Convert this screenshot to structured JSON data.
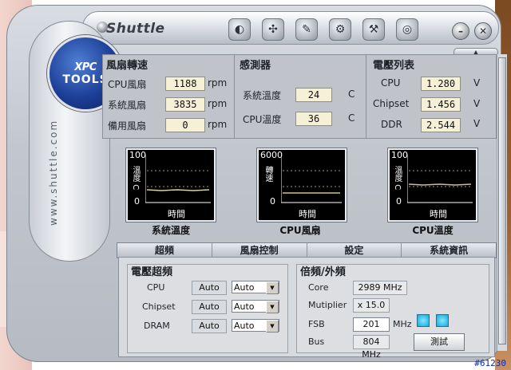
{
  "brand": "Shuttle",
  "logo": {
    "line1": "XPC",
    "line2": "TOOLS"
  },
  "side_url": "www.shuttle.com",
  "toolbar_icons": [
    "monitor-icon",
    "fan-icon",
    "wrench-icon",
    "gear-icon",
    "tools-icon",
    "lifebuoy-icon"
  ],
  "window_buttons": {
    "minimize": "–",
    "close": "✕"
  },
  "eject_label": "▲",
  "fans": {
    "title": "風扇轉速",
    "rows": [
      {
        "label": "CPU風扇",
        "value": "1188",
        "unit": "rpm"
      },
      {
        "label": "系統風扇",
        "value": "3835",
        "unit": "rpm"
      },
      {
        "label": "備用風扇",
        "value": "0",
        "unit": "rpm"
      }
    ]
  },
  "sensors": {
    "title": "感測器",
    "rows": [
      {
        "label": "系統溫度",
        "value": "24",
        "unit": "C"
      },
      {
        "label": "CPU溫度",
        "value": "36",
        "unit": "C"
      }
    ]
  },
  "voltages": {
    "title": "電壓列表",
    "rows": [
      {
        "label": "CPU",
        "value": "1.280",
        "unit": "V"
      },
      {
        "label": "Chipset",
        "value": "1.456",
        "unit": "V"
      },
      {
        "label": "DDR",
        "value": "2.544",
        "unit": "V"
      }
    ]
  },
  "graphs": [
    {
      "top": "100",
      "bottom": "0",
      "ylabel": "溫度 C",
      "xlabel": "時間",
      "title": "系統溫度",
      "line_color": "#d8d2a8"
    },
    {
      "top": "6000",
      "bottom": "0",
      "ylabel": "轉速",
      "xlabel": "時間",
      "title": "CPU風扇",
      "line_color": "#d8c46a"
    },
    {
      "top": "100",
      "bottom": "0",
      "ylabel": "溫度 C",
      "xlabel": "時間",
      "title": "CPU溫度",
      "line_color": "#c9c08e"
    }
  ],
  "tabs": [
    "超頻",
    "風扇控制",
    "設定",
    "系統資訊"
  ],
  "overvolt": {
    "title": "電壓超頻",
    "rows": [
      {
        "label": "CPU",
        "current": "Auto",
        "select": "Auto"
      },
      {
        "label": "Chipset",
        "current": "Auto",
        "select": "Auto"
      },
      {
        "label": "DRAM",
        "current": "Auto",
        "select": "Auto"
      }
    ]
  },
  "multiplier": {
    "title": "倍頻/外頻",
    "core_label": "Core",
    "core_value": "2989 MHz",
    "mult_label": "Mutiplier",
    "mult_value": "x 15.0",
    "fsb_label": "FSB",
    "fsb_value": "201",
    "fsb_unit": "MHz",
    "bus_label": "Bus",
    "bus_value": "804 MHz",
    "test_button": "測試"
  },
  "image_tag": "#61230"
}
